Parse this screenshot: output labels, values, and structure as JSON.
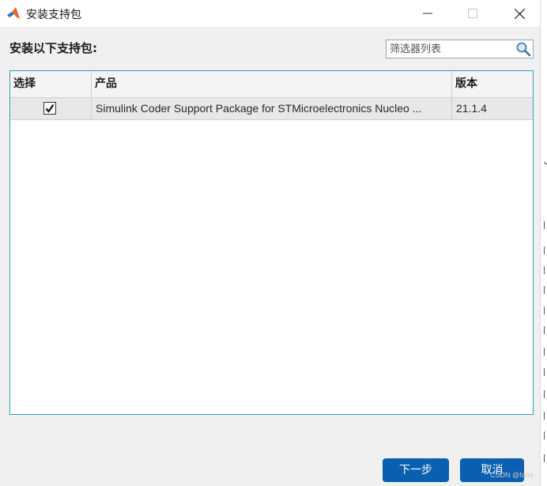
{
  "window": {
    "title": "安装支持包",
    "icon": "matlab-logo",
    "controls": [
      "minimize",
      "maximize",
      "close"
    ]
  },
  "heading": "安装以下支持包:",
  "search": {
    "placeholder": "筛选器列表",
    "value": ""
  },
  "table": {
    "columns": [
      "选择",
      "产品",
      "版本"
    ],
    "rows": [
      {
        "selected": true,
        "product": "Simulink Coder Support Package for STMicroelectronics Nucleo ...",
        "version": "21.1.4"
      }
    ]
  },
  "buttons": {
    "next": "下一步",
    "cancel": "取消"
  },
  "watermark": "CSDN @fami",
  "colors": {
    "accent_button": "#0b5fb0",
    "table_border": "#2aa4b6",
    "dialog_bg": "#f0f0f0"
  }
}
